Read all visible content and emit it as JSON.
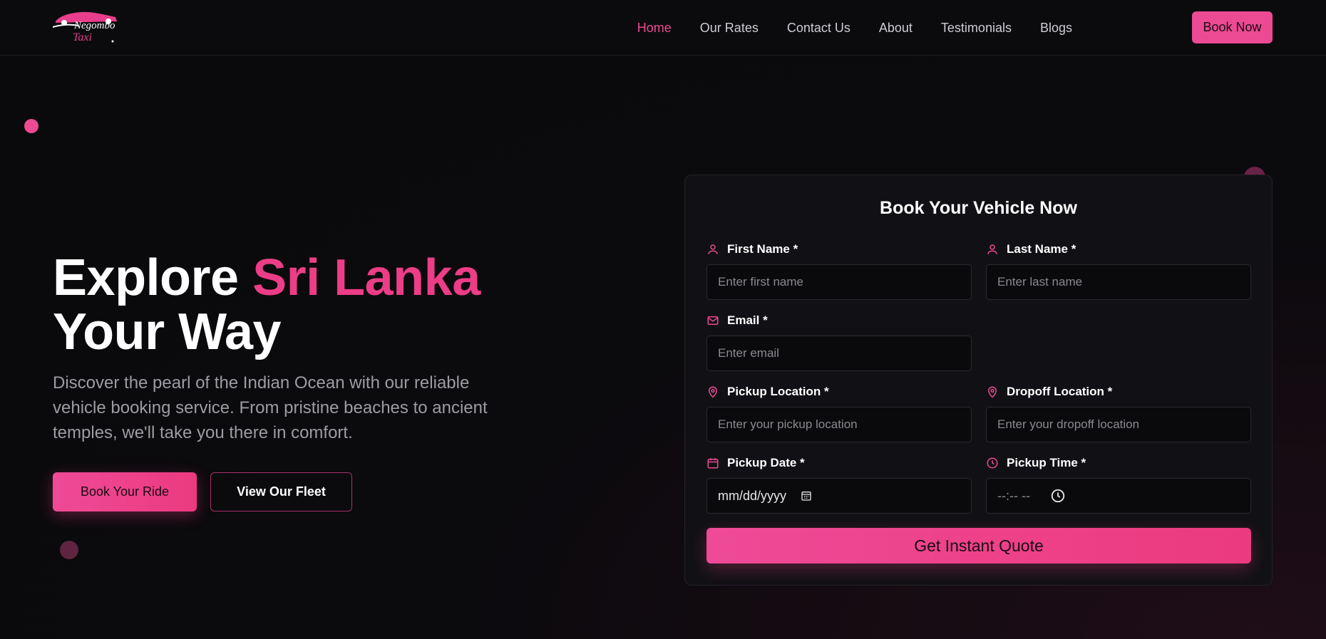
{
  "brand": {
    "line1": "Negombo",
    "line2": "Taxi"
  },
  "nav": {
    "links": [
      "Home",
      "Our Rates",
      "Contact Us",
      "About",
      "Testimonials",
      "Blogs"
    ],
    "active": "Home",
    "cta": "Book Now"
  },
  "hero": {
    "title_part1": "Explore ",
    "title_highlight": "Sri Lanka",
    "title_part2": "Your Way",
    "description": "Discover the pearl of the Indian Ocean with our reliable vehicle booking service. From pristine beaches to ancient temples, we'll take you there in comfort.",
    "primary_button": "Book Your Ride",
    "secondary_button": "View Our Fleet"
  },
  "form": {
    "title": "Book Your Vehicle Now",
    "first_name": {
      "label": "First Name *",
      "placeholder": "Enter first name"
    },
    "last_name": {
      "label": "Last Name *",
      "placeholder": "Enter last name"
    },
    "email": {
      "label": "Email *",
      "placeholder": "Enter email"
    },
    "pickup_location": {
      "label": "Pickup Location *",
      "placeholder": "Enter your pickup location"
    },
    "dropoff_location": {
      "label": "Dropoff Location *",
      "placeholder": "Enter your dropoff location"
    },
    "pickup_date": {
      "label": "Pickup Date *",
      "value": "mm/dd/yyyy"
    },
    "pickup_time": {
      "label": "Pickup Time *",
      "value": "--:-- --"
    },
    "submit": "Get Instant Quote"
  },
  "colors": {
    "accent": "#ec4a93",
    "background": "#0a0a0c",
    "card": "#111115"
  }
}
